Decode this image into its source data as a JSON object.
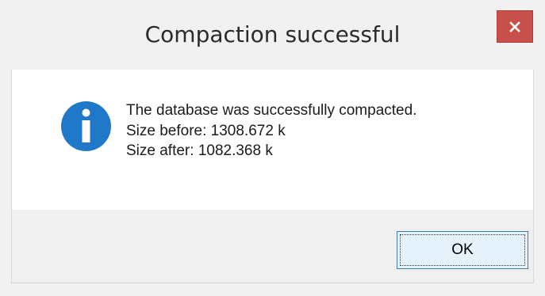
{
  "dialog": {
    "title": "Compaction successful",
    "close_icon": "close-icon",
    "message_icon": "info-icon",
    "message_lines": [
      "The database was successfully compacted.",
      "Size before: 1308.672 k",
      "Size after: 1082.368 k"
    ],
    "ok_label": "OK"
  },
  "colors": {
    "close_button": "#c7504c",
    "info_icon": "#1f78c8",
    "window_frame": "#f1f1f1"
  }
}
